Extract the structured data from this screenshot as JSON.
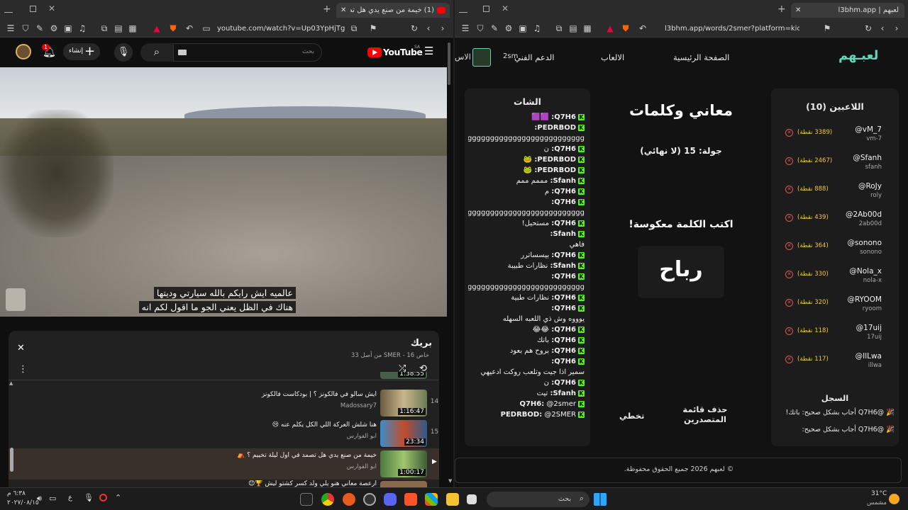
{
  "left_window": {
    "tab": {
      "title": "(1) خيمة من صنع يدي هل تصمد في",
      "close": "✕",
      "new": "+"
    },
    "url": "youtube.com/watch?v=Up03YpHjTg8&list...",
    "youtube": {
      "brand": "YouTube",
      "region": "SA",
      "search_placeholder": "بحث",
      "create_label": "إنشاء",
      "notif_count": "1"
    },
    "subtitles": [
      "عالميه ايش رايكم بالله سيارتي وديتها",
      "هناك في الظل يعني الجو ما اقول لكم انه"
    ],
    "playlist": {
      "title": "بريك",
      "meta": "خاص SMER - 16 من أصل 33",
      "items": [
        {
          "index": "",
          "title": "",
          "channel": "",
          "duration": "1:38:55"
        },
        {
          "index": "14",
          "title": "ايش سالو في فالكونز ؟ | بودكاست فالكونز",
          "channel": "Madossary7",
          "duration": "1:16:47"
        },
        {
          "index": "15",
          "title": "هنا شلش العركة اللي الكل يكلم عنه 😢",
          "channel": "ابو الفوارس",
          "duration": "23:34"
        },
        {
          "index": "▶",
          "title": "خيمة من صنع يدي هل تصمد في اول ليلة تخييم ؟ ⛺",
          "channel": "ابو الفوارس",
          "duration": "1:00:17"
        },
        {
          "index": "",
          "title": "أرعصة معاني هنو يلي ولد كسر كشتو ليش 🏆😊",
          "channel": "",
          "duration": ""
        }
      ]
    }
  },
  "right_window": {
    "tab": {
      "title": "لعبهم | l3bhm.app",
      "close": "✕",
      "new": "+"
    },
    "url": "l3bhm.app/words/2smer?platform=kick",
    "site": {
      "logo": "لعبـهم",
      "nav": {
        "home": "الصفحة الرئيسية",
        "games": "الالعاب",
        "support": "الدعم الفني",
        "user": "2sm",
        "partial": "الاس"
      },
      "players_title": "اللاعبين (10)",
      "players": [
        {
          "name": "@vM_7",
          "user": "vm-7",
          "points": "(3389 نقطة)"
        },
        {
          "name": "@Sfanh",
          "user": "sfanh",
          "points": "(2467 نقطة)"
        },
        {
          "name": "@RoJy",
          "user": "roly",
          "points": "(888 نقطة)"
        },
        {
          "name": "@2Ab00d",
          "user": "2ab00d",
          "points": "(439 نقطة)"
        },
        {
          "name": "@sonono",
          "user": "sonono",
          "points": "(364 نقطة)"
        },
        {
          "name": "@Nola_x",
          "user": "nola-x",
          "points": "(330 نقطة)"
        },
        {
          "name": "@RYOOM",
          "user": "ryoom",
          "points": "(320 نقطة)"
        },
        {
          "name": "@17uij",
          "user": "17uij",
          "points": "(118 نقطة)"
        },
        {
          "name": "@IlLwa",
          "user": "illwa",
          "points": "(117 نقطة)"
        }
      ],
      "log_title": "السجل",
      "log": [
        "🎉 @Q7H6 أجاب بشكل صحيح: باتك!",
        "🎉 @Q7H6 أجاب بشكل صحيح:"
      ],
      "game_title": "معاني وكلمات",
      "round": "جولة: 15 (لا نهائي)",
      "prompt": "اكتب الكلمة معكوسة!",
      "word": "رباح",
      "clear_leaderboard": "حذف قائمة المتصدرين",
      "skip": "تخطي",
      "chat_title": "الشات",
      "chat": [
        {
          "user": "Q7H6:",
          "msg": "🟪🟪"
        },
        {
          "user": "PEDRBOD:",
          "msg": ""
        },
        {
          "user": "",
          "msg": "gggggggggggggggggggggggggggggggggggggggg"
        },
        {
          "user": "Q7H6:",
          "msg": "ن"
        },
        {
          "user": "PEDRBOD:",
          "msg": "🐸"
        },
        {
          "user": "PEDRBOD:",
          "msg": "🐸"
        },
        {
          "user": "Sfanh:",
          "msg": "مممم ممم"
        },
        {
          "user": "Q7H6:",
          "msg": "م"
        },
        {
          "user": "Q7H6:",
          "msg": ""
        },
        {
          "user": "",
          "msg": "gggggggggggggggggggggggggggggggggggggggg"
        },
        {
          "user": "Q7H6:",
          "msg": "مستحيل!"
        },
        {
          "user": "Sfanh:",
          "msg": ""
        },
        {
          "user": "",
          "msg": "فاهي"
        },
        {
          "user": "Q7H6:",
          "msg": "بيسساترر"
        },
        {
          "user": "Sfanh:",
          "msg": "نظارات طبيبة"
        },
        {
          "user": "Q7H6:",
          "msg": ""
        },
        {
          "user": "",
          "msg": "gggggggggggggggggggggggggggggggggggggggg"
        },
        {
          "user": "Q7H6:",
          "msg": "نظارات طبية"
        },
        {
          "user": "Q7H6:",
          "msg": ""
        },
        {
          "user": "",
          "msg": "يوووه وش ذي اللعبه السهله"
        },
        {
          "user": "Q7H6:",
          "msg": "😂😂"
        },
        {
          "user": "Q7H6:",
          "msg": "باتك"
        },
        {
          "user": "Q7H6:",
          "msg": "بروح هم بعود"
        },
        {
          "user": "Q7H6:",
          "msg": ""
        },
        {
          "user": "",
          "msg": "سمير اذا جيت وتلعب روكت ادعيهي"
        },
        {
          "user": "Q7H6:",
          "msg": "ن"
        },
        {
          "user": "Sfanh:",
          "msg": "تيت"
        },
        {
          "user": "Q7H6:",
          "msg": "@2smer"
        },
        {
          "user": "PEDRBOD:",
          "msg": "@2SMER"
        }
      ],
      "footer": "© لعبهم 2026 جميع الحقوق محفوظة."
    }
  },
  "taskbar": {
    "search": "بحث",
    "weather": {
      "temp": "31°C",
      "desc": "مشمس"
    },
    "time": "٦:٣٨ م",
    "date": "٢٠٢٧/٠٨/١٥",
    "lang": "ع"
  }
}
